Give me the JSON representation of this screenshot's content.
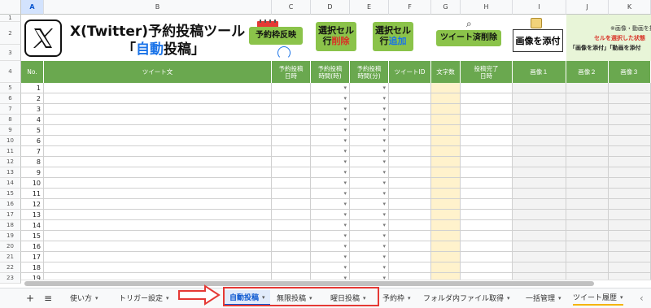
{
  "columns": {
    "A": "A",
    "B": "B",
    "C": "C",
    "D": "D",
    "E": "E",
    "F": "F",
    "G": "G",
    "H": "H",
    "I": "I",
    "J": "J",
    "K": "K"
  },
  "banner": {
    "title_line1": "X(Twitter)予約投稿ツール",
    "title_line2_open": "「",
    "title_line2_highlight": "自動",
    "title_line2_rest": "投稿」",
    "btn_reflect": "予約枠反映",
    "btn_delete_l1": "選択セル",
    "btn_delete_l2a": "行",
    "btn_delete_l2b": "削除",
    "btn_add_l1": "選択セル",
    "btn_add_l2a": "行",
    "btn_add_l2b": "追加",
    "btn_tweeted_delete": "ツイート済削除",
    "btn_attach_image": "画像を添付",
    "note1": "※画像・動画を挿入し",
    "note2": "セルを選択した状態",
    "note3": "「画像を添付」「動画を添付",
    "accent_green": "#6aa84f",
    "button_green": "#8bc34a"
  },
  "table_header": {
    "no": "No.",
    "tweet_text": "ツイート文",
    "post_datetime_l1": "予約投稿",
    "post_datetime_l2": "日時",
    "post_hour_l1": "予約投稿",
    "post_hour_l2": "時間(時)",
    "post_min_l1": "予約投稿",
    "post_min_l2": "時間(分)",
    "tweet_id": "ツイートID",
    "char_count": "文字数",
    "done_l1": "投稿完了",
    "done_l2": "日時",
    "image1": "画像１",
    "image2": "画像２",
    "image3": "画像３"
  },
  "row_labels": [
    "1",
    "2",
    "3",
    "4",
    "5",
    "6",
    "7",
    "8",
    "9",
    "10",
    "11",
    "12",
    "13",
    "14",
    "15",
    "16",
    "17",
    "18",
    "19",
    "20",
    "21",
    "22",
    "23"
  ],
  "rows": [
    {
      "rownum": "5",
      "no": "1"
    },
    {
      "rownum": "6",
      "no": "2"
    },
    {
      "rownum": "7",
      "no": "3"
    },
    {
      "rownum": "8",
      "no": "4"
    },
    {
      "rownum": "9",
      "no": "5"
    },
    {
      "rownum": "10",
      "no": "6"
    },
    {
      "rownum": "11",
      "no": "7"
    },
    {
      "rownum": "12",
      "no": "8"
    },
    {
      "rownum": "13",
      "no": "9"
    },
    {
      "rownum": "14",
      "no": "10"
    },
    {
      "rownum": "15",
      "no": "11"
    },
    {
      "rownum": "16",
      "no": "12"
    },
    {
      "rownum": "17",
      "no": "13"
    },
    {
      "rownum": "18",
      "no": "14"
    },
    {
      "rownum": "19",
      "no": "15"
    },
    {
      "rownum": "20",
      "no": "16"
    },
    {
      "rownum": "21",
      "no": "17"
    },
    {
      "rownum": "22",
      "no": "18"
    },
    {
      "rownum": "23",
      "no": "19"
    }
  ],
  "header_rows": [
    "1",
    "2",
    "3",
    "4"
  ],
  "tabs": [
    {
      "label": "使い方"
    },
    {
      "label": "トリガー設定"
    },
    {
      "label": "自動投稿",
      "active": true
    },
    {
      "label": "無限投稿"
    },
    {
      "label": "曜日投稿"
    },
    {
      "label": "予約枠"
    },
    {
      "label": "フォルダ内ファイル取得"
    },
    {
      "label": "一括管理"
    },
    {
      "label": "ツイート履歴"
    }
  ],
  "tab_add": "+",
  "tab_menu": "≡",
  "tab_prev": "‹",
  "highlight_color": "#e53935"
}
